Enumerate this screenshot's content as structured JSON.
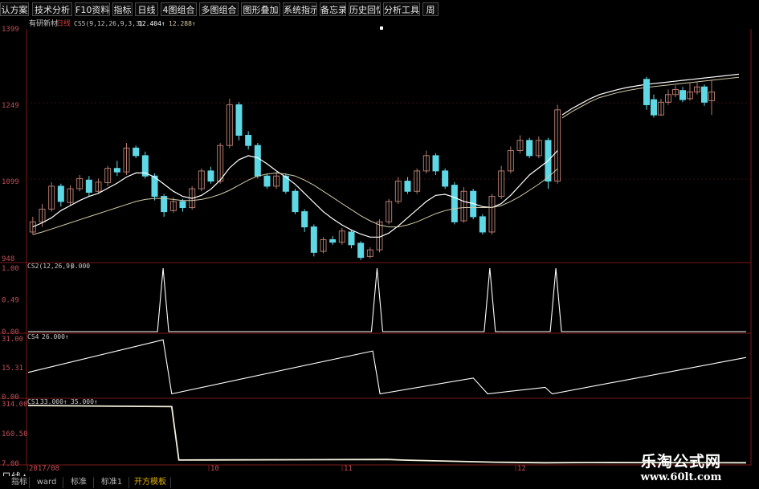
{
  "menu": {
    "items": [
      "认方案",
      "技术分析",
      "F10资料",
      "指标",
      "日线",
      "4图组合",
      "多图组合",
      "图形叠加",
      "系统指示",
      "备忘录",
      "历史回忆",
      "分析工具",
      "周"
    ]
  },
  "main_panel": {
    "stock_name": "有研新材",
    "period": "日线",
    "indicator_label": "CS5(9,12,26,9,3,3)",
    "value1": "12.404↑",
    "value2": "12.288↑"
  },
  "panel2": {
    "label": "CS2(12,26,9)",
    "value": "0.000"
  },
  "panel3": {
    "label": "CS4",
    "value": "26.000↑"
  },
  "panel4": {
    "label": "CS1",
    "value1": "33.000↑",
    "value2": "35.000↑"
  },
  "statusbar": {
    "tabs": [
      "指标",
      "ward",
      "标准",
      "标准1",
      "开方模板"
    ],
    "active_tab": "开方模板",
    "day_marker": "日线▲"
  },
  "watermark": {
    "title": "乐淘公式网",
    "url": "www.60lt.com"
  },
  "colors": {
    "up": "#b07a6e",
    "down": "#5fd8e6",
    "ma1": "#ffffff",
    "ma2": "#d2c8a8",
    "grid": "#7a1a1a",
    "axis_text": "#c0505a"
  },
  "chart_data": [
    {
      "type": "candlestick",
      "panel": "main",
      "ylim": [
        940,
        1399
      ],
      "yticks": [
        948,
        1099,
        1249,
        1399
      ],
      "x_labels": [
        "2017/08",
        "10",
        "11",
        "12"
      ],
      "candles": [
        [
          1000,
          1020,
          1030,
          995
        ],
        [
          1020,
          1045,
          1055,
          1010
        ],
        [
          1045,
          1090,
          1098,
          1040
        ],
        [
          1090,
          1060,
          1095,
          1050
        ],
        [
          1058,
          1085,
          1092,
          1052
        ],
        [
          1085,
          1105,
          1112,
          1080
        ],
        [
          1102,
          1078,
          1110,
          1070
        ],
        [
          1080,
          1098,
          1105,
          1075
        ],
        [
          1097,
          1125,
          1130,
          1090
        ],
        [
          1125,
          1118,
          1140,
          1110
        ],
        [
          1118,
          1165,
          1175,
          1112
        ],
        [
          1165,
          1150,
          1170,
          1145
        ],
        [
          1150,
          1110,
          1158,
          1105
        ],
        [
          1110,
          1070,
          1115,
          1062
        ],
        [
          1070,
          1040,
          1075,
          1030
        ],
        [
          1042,
          1060,
          1068,
          1038
        ],
        [
          1060,
          1048,
          1065,
          1040
        ],
        [
          1048,
          1085,
          1090,
          1044
        ],
        [
          1085,
          1120,
          1125,
          1080
        ],
        [
          1120,
          1100,
          1128,
          1095
        ],
        [
          1100,
          1170,
          1175,
          1095
        ],
        [
          1170,
          1250,
          1262,
          1165
        ],
        [
          1250,
          1190,
          1255,
          1180
        ],
        [
          1190,
          1170,
          1198,
          1162
        ],
        [
          1170,
          1110,
          1175,
          1105
        ],
        [
          1110,
          1090,
          1115,
          1085
        ],
        [
          1090,
          1110,
          1118,
          1085
        ],
        [
          1110,
          1080,
          1115,
          1075
        ],
        [
          1080,
          1040,
          1085,
          1035
        ],
        [
          1040,
          1010,
          1045,
          1000
        ],
        [
          1010,
          960,
          1015,
          952
        ],
        [
          962,
          985,
          990,
          958
        ],
        [
          985,
          980,
          992,
          975
        ],
        [
          980,
          1002,
          1008,
          975
        ],
        [
          1000,
          975,
          1005,
          968
        ],
        [
          978,
          950,
          982,
          945
        ],
        [
          952,
          965,
          970,
          948
        ],
        [
          965,
          1020,
          1025,
          960
        ],
        [
          1020,
          1060,
          1065,
          1015
        ],
        [
          1060,
          1100,
          1108,
          1055
        ],
        [
          1100,
          1080,
          1108,
          1075
        ],
        [
          1080,
          1120,
          1125,
          1075
        ],
        [
          1120,
          1150,
          1160,
          1115
        ],
        [
          1150,
          1120,
          1155,
          1112
        ],
        [
          1120,
          1090,
          1125,
          1085
        ],
        [
          1092,
          1020,
          1098,
          1015
        ],
        [
          1022,
          1080,
          1088,
          1018
        ],
        [
          1080,
          1030,
          1085,
          1025
        ],
        [
          1030,
          1000,
          1035,
          995
        ],
        [
          1000,
          1070,
          1075,
          995
        ],
        [
          1070,
          1120,
          1130,
          1065
        ],
        [
          1120,
          1160,
          1168,
          1115
        ],
        [
          1160,
          1180,
          1190,
          1155
        ],
        [
          1180,
          1150,
          1185,
          1145
        ],
        [
          1150,
          1180,
          1188,
          1145
        ],
        [
          1180,
          1100,
          1185,
          1085
        ],
        [
          1100,
          1240,
          1250,
          1095
        ]
      ],
      "ma_fast": [
        1010,
        1018,
        1028,
        1042,
        1052,
        1062,
        1070,
        1076,
        1086,
        1096,
        1108,
        1116,
        1116,
        1108,
        1094,
        1080,
        1070,
        1066,
        1072,
        1084,
        1102,
        1126,
        1142,
        1150,
        1146,
        1134,
        1120,
        1108,
        1094,
        1076,
        1058,
        1040,
        1026,
        1014,
        1004,
        996,
        990,
        990,
        998,
        1012,
        1028,
        1044,
        1060,
        1072,
        1074,
        1068,
        1060,
        1056,
        1050,
        1048,
        1056,
        1072,
        1092,
        1112,
        1126,
        1140,
        1160
      ],
      "ma_slow": [
        995,
        1000,
        1006,
        1012,
        1018,
        1024,
        1030,
        1036,
        1042,
        1048,
        1054,
        1060,
        1064,
        1066,
        1066,
        1064,
        1062,
        1062,
        1064,
        1068,
        1074,
        1082,
        1092,
        1102,
        1110,
        1114,
        1116,
        1114,
        1110,
        1102,
        1092,
        1080,
        1068,
        1056,
        1044,
        1032,
        1022,
        1014,
        1010,
        1010,
        1014,
        1020,
        1028,
        1036,
        1042,
        1046,
        1048,
        1048,
        1048,
        1048,
        1052,
        1060,
        1070,
        1082,
        1094,
        1108,
        1124
      ],
      "ma_right": [
        1230,
        1242,
        1252,
        1262,
        1270,
        1275,
        1280,
        1284,
        1287,
        1290,
        1292,
        1294,
        1296,
        1298,
        1300,
        1302,
        1304,
        1306,
        1308,
        1310
      ]
    },
    {
      "type": "line",
      "panel": "CS2",
      "ylim": [
        0,
        1.0
      ],
      "yticks": [
        0.0,
        0.49,
        1.0
      ],
      "spikes_at_fraction": [
        0.188,
        0.486,
        0.643,
        0.735
      ],
      "baseline": 0.0,
      "peak": 1.0
    },
    {
      "type": "line",
      "panel": "CS4",
      "ylim": [
        0,
        31
      ],
      "yticks": [
        0.0,
        15.31,
        31.0
      ],
      "points": [
        [
          0,
          13
        ],
        [
          0.188,
          30.5
        ],
        [
          0.2,
          1.5
        ],
        [
          0.48,
          24.5
        ],
        [
          0.49,
          1.5
        ],
        [
          0.62,
          10
        ],
        [
          0.64,
          1.5
        ],
        [
          0.72,
          5
        ],
        [
          0.73,
          1.5
        ],
        [
          1,
          21
        ]
      ]
    },
    {
      "type": "line",
      "panel": "CS1",
      "ylim": [
        6,
        115
      ],
      "yticks": [
        7.0,
        160.5,
        314.0
      ],
      "points": [
        [
          0,
          112
        ],
        [
          0.2,
          110
        ],
        [
          0.21,
          12
        ],
        [
          0.5,
          13
        ],
        [
          0.52,
          12
        ],
        [
          0.65,
          8
        ],
        [
          0.72,
          7
        ],
        [
          0.78,
          7.5
        ],
        [
          1,
          7
        ]
      ]
    }
  ]
}
